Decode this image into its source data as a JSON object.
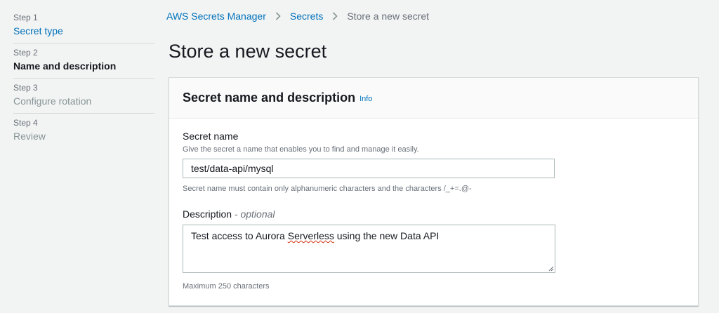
{
  "steps": [
    {
      "num": "Step 1",
      "title": "Secret type"
    },
    {
      "num": "Step 2",
      "title": "Name and description"
    },
    {
      "num": "Step 3",
      "title": "Configure rotation"
    },
    {
      "num": "Step 4",
      "title": "Review"
    }
  ],
  "breadcrumb": {
    "service": "AWS Secrets Manager",
    "section": "Secrets",
    "current": "Store a new secret"
  },
  "page": {
    "title": "Store a new secret"
  },
  "panel": {
    "title": "Secret name and description",
    "info": "Info",
    "secret_name": {
      "label": "Secret name",
      "description": "Give the secret a name that enables you to find and manage it easily.",
      "value": "test/data-api/mysql",
      "constraint": "Secret name must contain only alphanumeric characters and the characters /_+=.@-"
    },
    "description": {
      "label": "Description",
      "optional": "- optional",
      "value_before": "Test access to Aurora ",
      "value_flagged": "Serverless",
      "value_after": " using the new Data API",
      "constraint": "Maximum 250 characters"
    }
  },
  "colors": {
    "link": "#0073bb",
    "background": "#f2f3f3",
    "muted": "#687078",
    "spellcheck": "#d13212"
  }
}
